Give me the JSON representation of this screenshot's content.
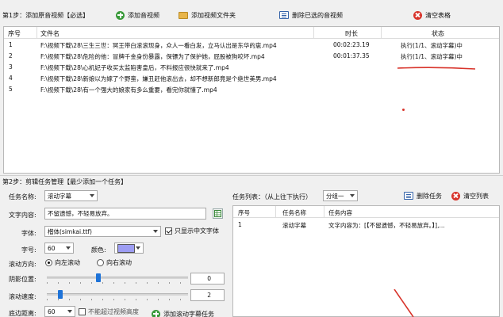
{
  "step1": {
    "label": "第1步：添加原音视频【必选】",
    "add_video": "添加音视频",
    "add_folder": "添加视频文件夹",
    "delete_selected": "删除已选的音视频",
    "clear_table": "清空表格"
  },
  "file_table": {
    "columns": [
      "序号",
      "文件名",
      "时长",
      "状态"
    ],
    "rows": [
      {
        "no": "1",
        "name": "F:\\视频下载\\28\\三生三世：冥王带白滚滚现身，众人一看白发，立马认出是东华的崽.mp4",
        "duration": "00:02:23.19",
        "status": "执行(1/1、滚动字幕)中"
      },
      {
        "no": "2",
        "name": "F:\\视频下载\\28\\危险的他：冒牌千金身份暴露，保镖为了保护她，屁股被狗咬坏.mp4",
        "duration": "00:01:37.35",
        "status": "执行(1/1、滚动字幕)中"
      },
      {
        "no": "3",
        "name": "F:\\视频下载\\28\\心机妃子收买太监陷害皇后，不料报应很快就来了.mp4",
        "duration": "",
        "status": ""
      },
      {
        "no": "4",
        "name": "F:\\视频下载\\28\\新娘以为嫁了个野蛮，嫌丑赶他滚出去，却不想新郎竟是个绝世美男.mp4",
        "duration": "",
        "status": ""
      },
      {
        "no": "5",
        "name": "F:\\视频下载\\28\\有一个强大的娘家有多么重要，看完你就懂了.mp4",
        "duration": "",
        "status": ""
      }
    ]
  },
  "step2": {
    "label": "第2步：剪辑任务管理【最少添加一个任务】",
    "task_name_label": "任务名称:",
    "task_name_value": "滚动字幕",
    "text_label": "文字内容:",
    "text_value": "不留遗憾，不轻易放弃。",
    "font_label": "字体:",
    "font_value": "楷体(simkai.ttf)",
    "chinese_only_label": "只显示中文字体",
    "chinese_only_checked": true,
    "size_label": "字号:",
    "size_value": "60",
    "color_label": "颜色:",
    "color_value": "#9d9df3",
    "direction_label": "滚动方向:",
    "direction_left": "向左滚动",
    "direction_right": "向右滚动",
    "shadow_label": "阴影位置:",
    "shadow_value": "0",
    "shadow_level": 0.36,
    "speed_label": "滚动速度:",
    "speed_value": "2",
    "speed_level": 0.08,
    "bottom_label": "底边距离:",
    "bottom_value": "60",
    "no_exceed_label": "不能超过视频高度",
    "add_task": "添加滚动字幕任务"
  },
  "task_list": {
    "label": "任务列表：（从上往下执行）",
    "group_value": "分组一",
    "delete_task": "删除任务",
    "clear_list": "清空列表",
    "columns": [
      "序号",
      "任务名称",
      "任务内容"
    ],
    "rows": [
      {
        "no": "1",
        "name": "滚动字幕",
        "content": "文字内容为：[【不留遗憾，不轻易放弃。】],..."
      }
    ]
  },
  "colors": {
    "annotation": "#d8342b",
    "slider_thumb": "#1e73d8"
  }
}
